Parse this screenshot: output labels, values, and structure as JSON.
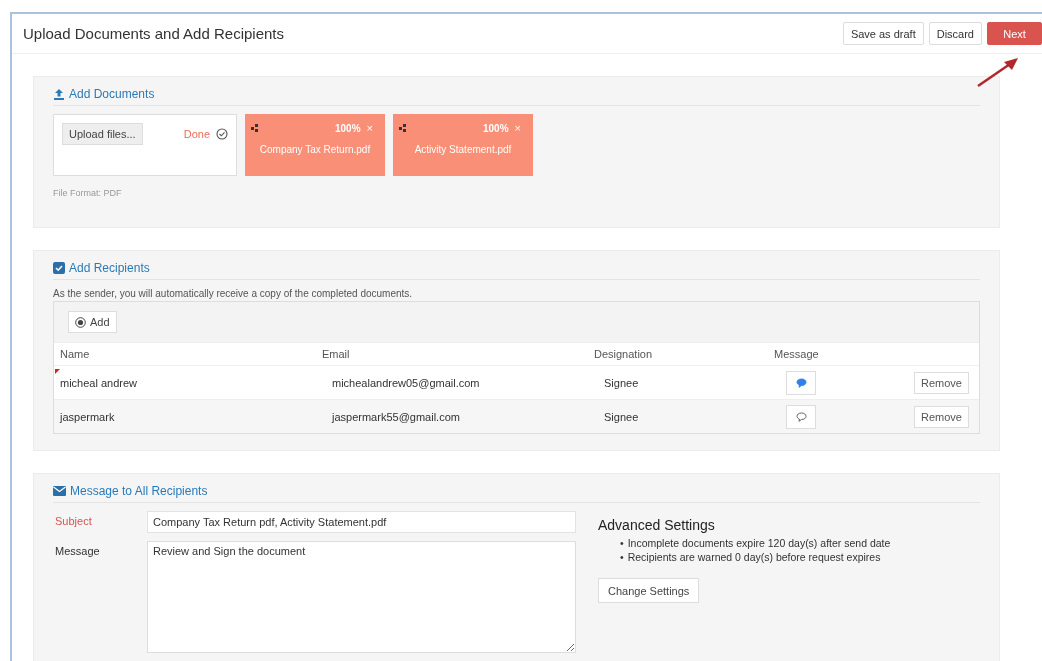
{
  "window": {
    "title": "Upload Documents and Add Recipients"
  },
  "header_buttons": [
    {
      "label": "Save as draft",
      "kind": "default"
    },
    {
      "label": "Discard",
      "kind": "default"
    },
    {
      "label": "Next",
      "kind": "primary"
    }
  ],
  "documents": {
    "heading": "Add Documents",
    "upload_button": "Upload files...",
    "status": "Done",
    "format_note": "File Format: PDF",
    "files": [
      {
        "name": "Company Tax Return.pdf",
        "progress": "100%",
        "close": "×"
      },
      {
        "name": "Activity Statement.pdf",
        "progress": "100%",
        "close": "×"
      }
    ]
  },
  "recipients": {
    "heading": "Add Recipients",
    "note": "As the sender, you will automatically receive a copy of the completed documents.",
    "add_button": "Add",
    "columns": [
      "Name",
      "Email",
      "Designation",
      "Message"
    ],
    "rows": [
      {
        "name": "micheal andrew",
        "email": "michealandrew05@gmail.com",
        "designation": "Signee",
        "has_message": true,
        "marked": true,
        "remove": "Remove"
      },
      {
        "name": "jaspermark",
        "email": "jaspermark55@gmail.com",
        "designation": "Signee",
        "has_message": false,
        "marked": false,
        "remove": "Remove"
      }
    ]
  },
  "message": {
    "heading": "Message to All Recipients",
    "fields": [
      {
        "label": "Subject",
        "kind": "input",
        "required": true,
        "value": "Company Tax Return pdf, Activity Statement.pdf"
      },
      {
        "label": "Message",
        "kind": "textarea",
        "required": false,
        "value": "Review and Sign the document"
      }
    ],
    "advanced": {
      "title": "Advanced Settings",
      "items": [
        {
          "bullet": "•",
          "text": "Incomplete documents expire 120 day(s) after send date"
        },
        {
          "bullet": "•",
          "text": "Recipients are warned 0 day(s) before request expires"
        }
      ],
      "button": "Change Settings"
    }
  }
}
